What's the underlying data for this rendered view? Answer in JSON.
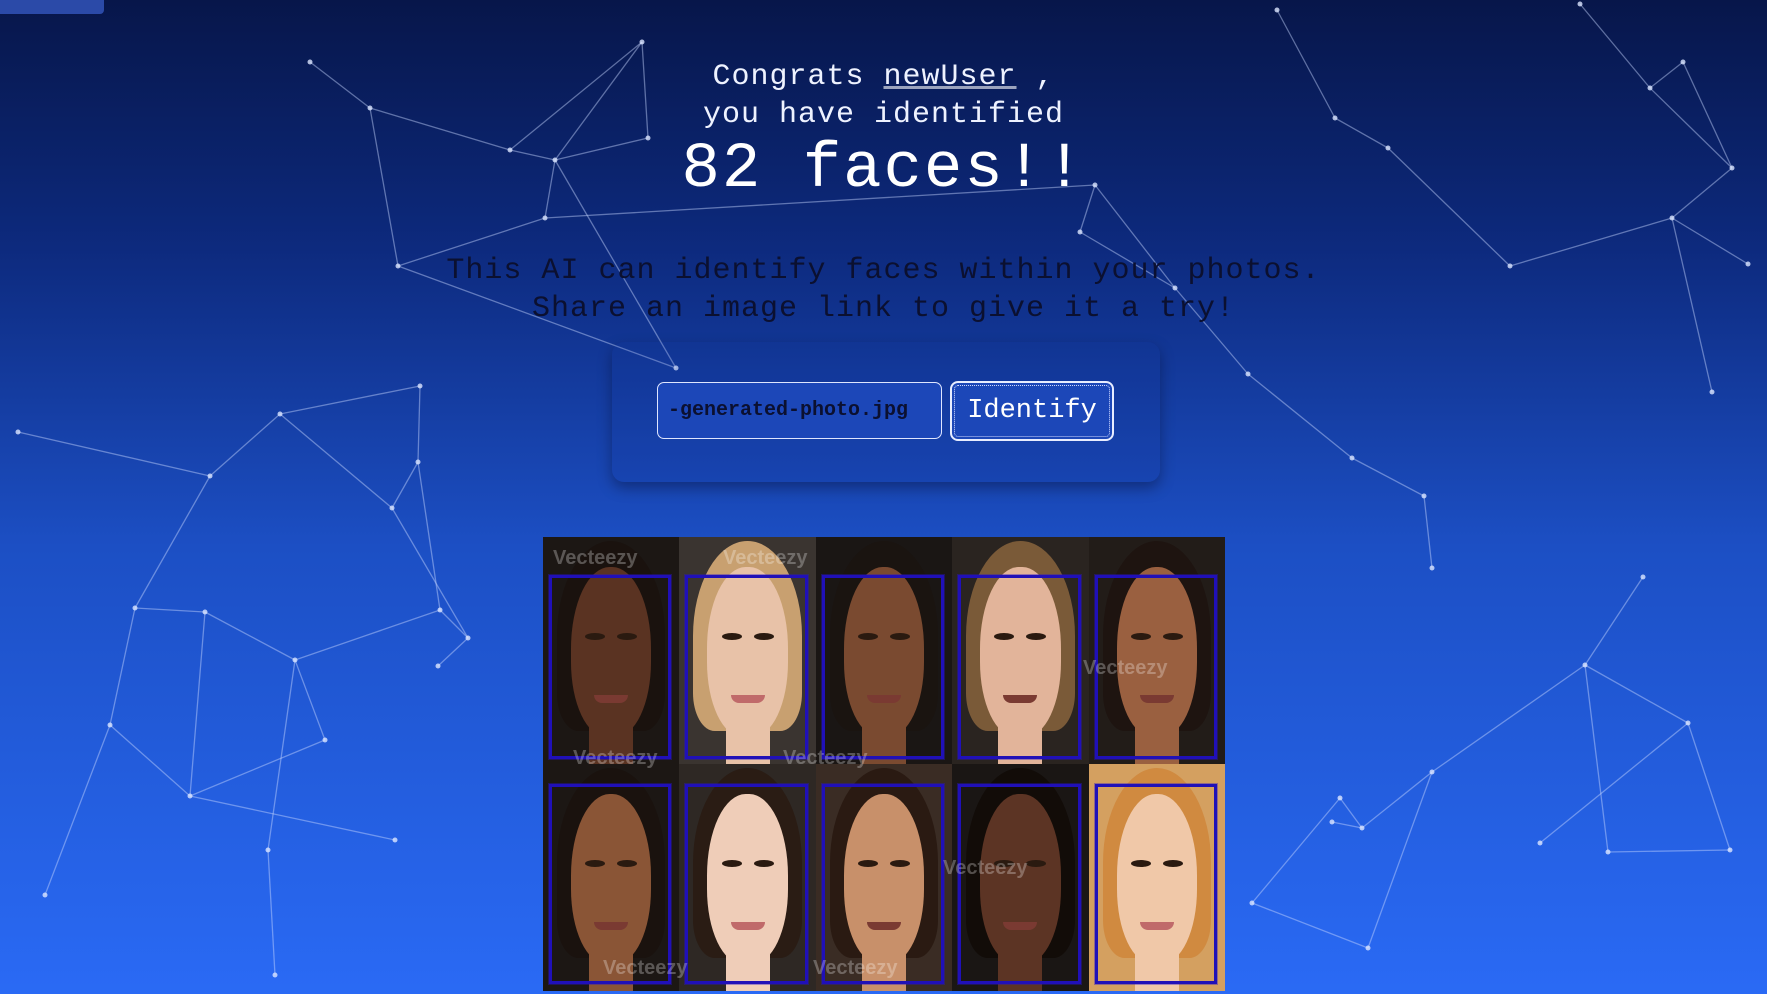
{
  "greeting": {
    "prefix": "Congrats",
    "user": "newUser",
    "suffix": ",",
    "line2": "you have identified",
    "count_line": "82 faces!!"
  },
  "description": {
    "line1": "This AI can identify faces within your photos.",
    "line2": "Share an image link to give it a try!"
  },
  "form": {
    "url_value": "-generated-photo.jpg",
    "submit_label": "Identify"
  },
  "result": {
    "watermark": "Vecteezy",
    "face_boxes_count": 10
  },
  "colors": {
    "background_top": "#07164a",
    "background_bottom": "#2a6af5",
    "box_border": "#2010b8"
  }
}
